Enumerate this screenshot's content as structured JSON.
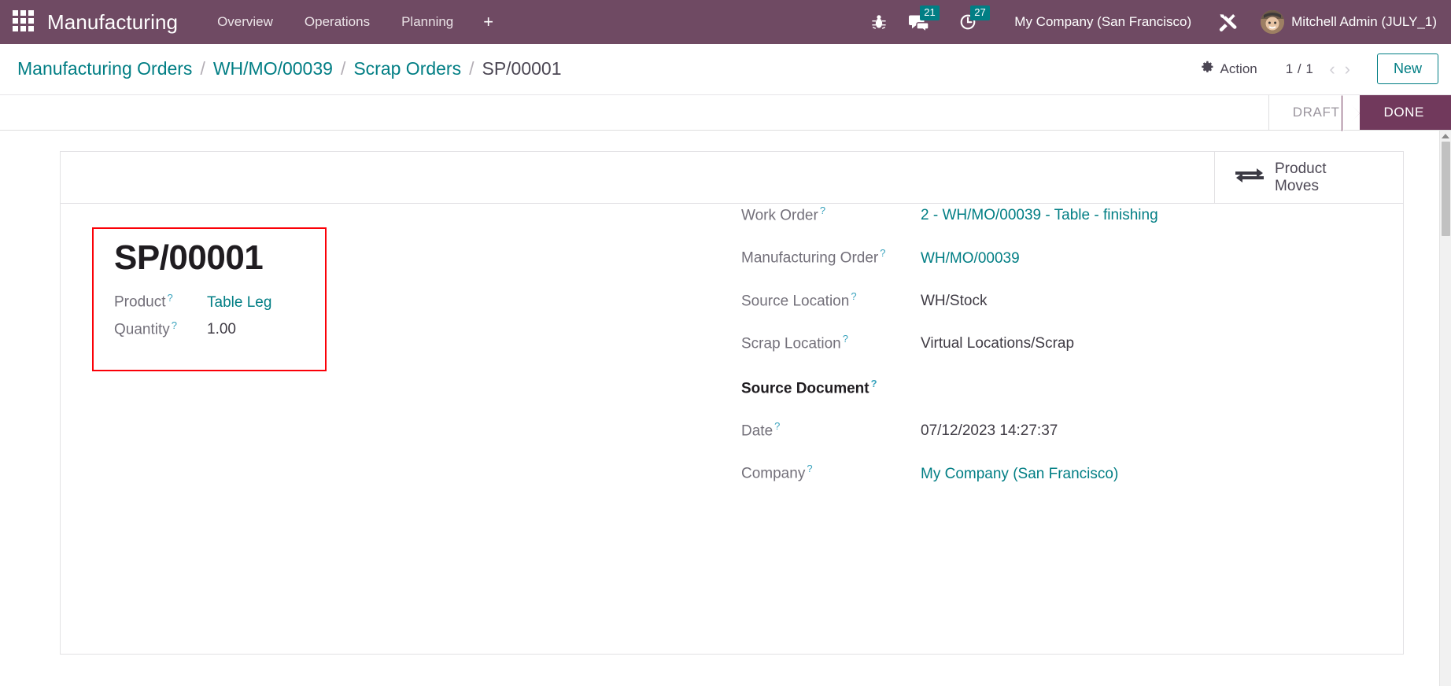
{
  "navbar": {
    "apps_icon": "apps-grid-icon",
    "brand": "Manufacturing",
    "menu_items": [
      {
        "label": "Overview"
      },
      {
        "label": "Operations"
      },
      {
        "label": "Planning"
      }
    ],
    "add_menu_label": "+",
    "icons": [
      {
        "name": "bug-icon",
        "label": ""
      },
      {
        "name": "messages-icon",
        "badge": "21"
      },
      {
        "name": "activities-clock-icon",
        "badge": "27"
      }
    ],
    "company": "My Company (San Francisco)",
    "tools_icon": "tools-icon",
    "user": "Mitchell Admin (JULY_1)",
    "colors": {
      "navbar_bg": "#6f4a63",
      "badge_bg": "#017e84"
    }
  },
  "control_panel": {
    "breadcrumb": [
      {
        "label": "Manufacturing Orders",
        "current": false
      },
      {
        "label": "WH/MO/00039",
        "current": false
      },
      {
        "label": "Scrap Orders",
        "current": false
      },
      {
        "label": "SP/00001",
        "current": true
      }
    ],
    "separator": "/",
    "action_label": "Action",
    "action_icon": "gear-icon",
    "pager_value": "1 / 1",
    "pager_prev_icon": "chevron-left-icon",
    "pager_next_icon": "chevron-right-icon",
    "new_label": "New",
    "accent_color": "#017e84"
  },
  "statusbar": {
    "steps": [
      {
        "label": "DRAFT",
        "active": false
      },
      {
        "label": "DONE",
        "active": true
      }
    ],
    "active_color": "#71395c"
  },
  "smart_buttons": [
    {
      "icon": "exchange-arrows-icon",
      "line1": "Product",
      "line2": "Moves"
    }
  ],
  "form": {
    "title": "SP/00001",
    "highlight_color": "#fb0007",
    "help_mark": "?",
    "left_fields": [
      {
        "label": "Product",
        "value": "Table Leg",
        "is_link": true,
        "bold_label": false
      },
      {
        "label": "Quantity",
        "value": "1.00",
        "is_link": false,
        "bold_label": false
      }
    ],
    "right_fields": [
      {
        "label": "Work Order",
        "value": "2 - WH/MO/00039 - Table - finishing",
        "is_link": true,
        "bold_label": false
      },
      {
        "label": "Manufacturing Order",
        "value": "WH/MO/00039",
        "is_link": true,
        "bold_label": false
      },
      {
        "label": "Source Location",
        "value": "WH/Stock",
        "is_link": false,
        "bold_label": false
      },
      {
        "label": "Scrap Location",
        "value": "Virtual Locations/Scrap",
        "is_link": false,
        "bold_label": false
      },
      {
        "label": "Source Document",
        "value": "",
        "is_link": false,
        "bold_label": true
      },
      {
        "label": "Date",
        "value": "07/12/2023 14:27:37",
        "is_link": false,
        "bold_label": false
      },
      {
        "label": "Company",
        "value": "My Company (San Francisco)",
        "is_link": true,
        "bold_label": false
      }
    ]
  }
}
